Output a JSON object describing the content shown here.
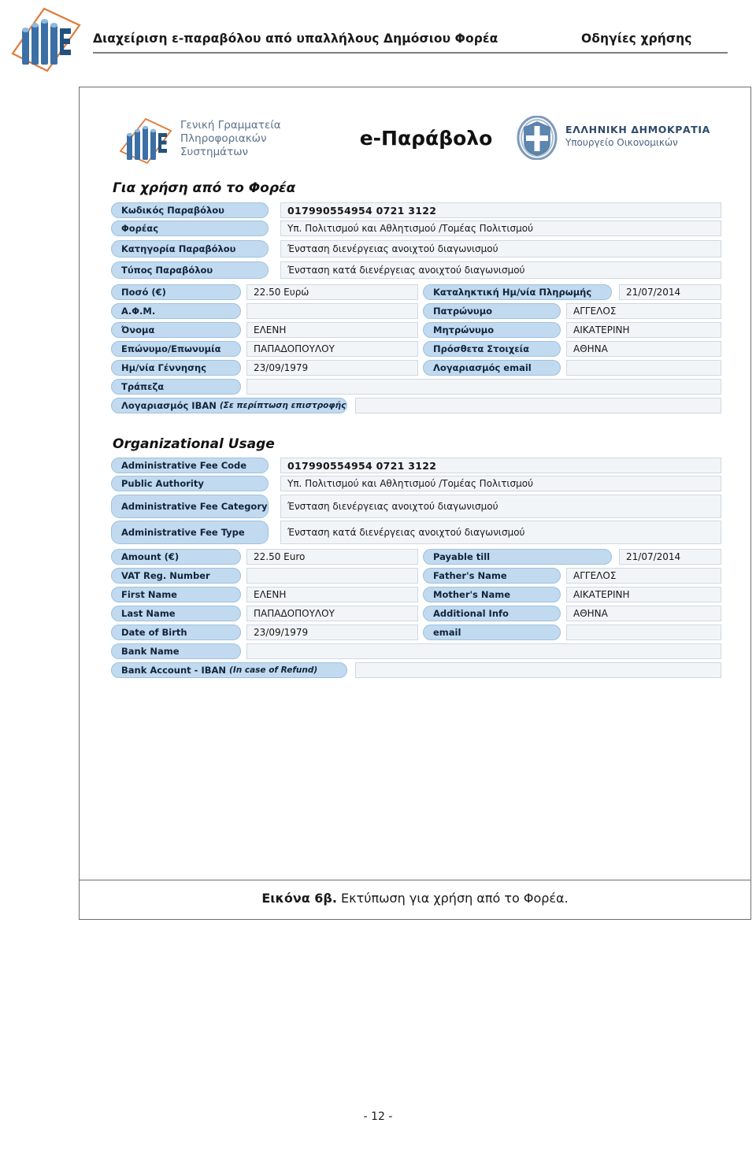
{
  "page_header": {
    "doc_title": "Διαχείριση ε-παραβόλου από υπαλλήλους Δημόσιου Φορέα",
    "doc_subtitle": "Οδηγίες χρήσης",
    "logo_icon": "gsis-logo-icon"
  },
  "figure": {
    "caption_strong": "Εικόνα 6β.",
    "caption_rest": " Εκτύπωση για χρήση από το Φορέα."
  },
  "doc_header": {
    "gsis_logo_icon": "gsis-logo-icon",
    "gsis_line1": "Γενική Γραμματεία",
    "gsis_line2": "Πληροφοριακών",
    "gsis_line3": "Συστημάτων",
    "wordmark": "e-Παράβολο",
    "hellenic_emblem_icon": "hellenic-republic-emblem-icon",
    "hellenic_title": "ΕΛΛΗΝΙΚΗ ΔΗΜΟΚΡΑΤΙΑ",
    "hellenic_sub": "Υπουργείο Οικονομικών"
  },
  "greek_section": {
    "title": "Για χρήση από το Φορέα",
    "rows": [
      {
        "label": "Κωδικός Παραβόλου",
        "value": "017990554954   0721   3122",
        "bold_value": true
      },
      {
        "label": "Φορέας",
        "value": "Υπ. Πολιτισμού και Αθλητισμού /Τομέας Πολιτισμού"
      },
      {
        "label": "Κατηγορία Παραβόλου",
        "value": "Ένσταση διενέργειας ανοιχτού διαγωνισμού"
      },
      {
        "label": "Τύπος Παραβόλου",
        "value": "Ένσταση κατά διενέργειας ανοιχτού διαγωνισμού"
      }
    ],
    "pair_rows": [
      {
        "left_label": "Ποσό (€)",
        "left_value": "22.50 Ευρώ",
        "right_label": "Καταληκτική Ημ/νία Πληρωμής",
        "right_value": "21/07/2014"
      },
      {
        "left_label": "Α.Φ.Μ.",
        "left_value": "",
        "right_label": "Πατρώνυμο",
        "right_value": "ΑΓΓΕΛΟΣ"
      },
      {
        "left_label": "Όνομα",
        "left_value": "ΕΛΕΝΗ",
        "right_label": "Μητρώνυμο",
        "right_value": "ΑΙΚΑΤΕΡΙΝΗ"
      },
      {
        "left_label": "Επώνυμο/Επωνυμία",
        "left_value": "ΠΑΠΑΔΟΠΟΥΛΟΥ",
        "right_label": "Πρόσθετα Στοιχεία",
        "right_value": "ΑΘΗΝΑ"
      },
      {
        "left_label": "Ημ/νία Γέννησης",
        "left_value": "23/09/1979",
        "right_label": "Λογαριασμός email",
        "right_value": ""
      }
    ],
    "bank_label": "Τράπεζα",
    "bank_value": "",
    "iban_label": "Λογαριασμός IBAN",
    "iban_note": "(Σε περίπτωση επιστροφής)",
    "iban_value": ""
  },
  "english_section": {
    "title": "Organizational Usage",
    "rows": [
      {
        "label": "Administrative Fee Code",
        "value": "017990554954   0721   3122",
        "bold_value": true
      },
      {
        "label": "Public Authority",
        "value": "Υπ. Πολιτισμού και Αθλητισμού /Τομέας Πολιτισμού"
      },
      {
        "label": "Administrative Fee Category",
        "value": "Ένσταση διενέργειας ανοιχτού διαγωνισμού"
      },
      {
        "label": "Administrative Fee Type",
        "value": "Ένσταση κατά διενέργειας ανοιχτού διαγωνισμού"
      }
    ],
    "pair_rows": [
      {
        "left_label": "Amount (€)",
        "left_value": "22.50 Euro",
        "right_label": "Payable till",
        "right_value": "21/07/2014"
      },
      {
        "left_label": "VAT Reg. Number",
        "left_value": "",
        "right_label": "Father's Name",
        "right_value": "ΑΓΓΕΛΟΣ"
      },
      {
        "left_label": "First Name",
        "left_value": "ΕΛΕΝΗ",
        "right_label": "Mother's Name",
        "right_value": "ΑΙΚΑΤΕΡΙΝΗ"
      },
      {
        "left_label": "Last Name",
        "left_value": "ΠΑΠΑΔΟΠΟΥΛΟΥ",
        "right_label": "Additional Info",
        "right_value": "ΑΘΗΝΑ"
      },
      {
        "left_label": "Date of Birth",
        "left_value": "23/09/1979",
        "right_label": "email",
        "right_value": ""
      }
    ],
    "bank_label": "Bank Name",
    "bank_value": "",
    "iban_label": "Bank Account - IBAN",
    "iban_note": "(In case of Refund)",
    "iban_value": ""
  },
  "footer": {
    "page_number": "- 12 -"
  },
  "colors": {
    "pill_fill": "#c2daef",
    "pill_border": "#9cc2de",
    "value_fill": "#f2f5f8",
    "value_border": "#cfd8e0",
    "frame_border": "#6e6e6e",
    "header_rule": "#7f7f7f",
    "hellenic_blue": "#2e4a6b"
  }
}
